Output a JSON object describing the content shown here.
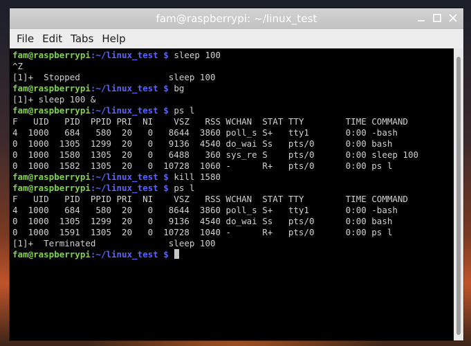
{
  "window": {
    "title": "fam@raspberrypi: ~/linux_test"
  },
  "menu": [
    "File",
    "Edit",
    "Tabs",
    "Help"
  ],
  "prompt": {
    "user": "fam@raspberrypi",
    "path": ":~/linux_test $"
  },
  "lines": [
    {
      "type": "prompt",
      "cmd": "sleep 100"
    },
    {
      "type": "out",
      "text": "^Z"
    },
    {
      "type": "out",
      "text": "[1]+  Stopped                 sleep 100"
    },
    {
      "type": "prompt",
      "cmd": "bg"
    },
    {
      "type": "out",
      "text": "[1]+ sleep 100 &"
    },
    {
      "type": "prompt",
      "cmd": "ps l"
    },
    {
      "type": "out",
      "text": "F   UID   PID  PPID PRI  NI    VSZ   RSS WCHAN  STAT TTY        TIME COMMAND"
    },
    {
      "type": "out",
      "text": "4  1000   684   580  20   0   8644  3860 poll_s S+   tty1       0:00 -bash"
    },
    {
      "type": "out",
      "text": "0  1000  1305  1299  20   0   9136  4540 do_wai Ss   pts/0      0:00 bash"
    },
    {
      "type": "out",
      "text": "0  1000  1580  1305  20   0   6488   360 sys_re S    pts/0      0:00 sleep 100"
    },
    {
      "type": "out",
      "text": "0  1000  1582  1305  20   0  10728  1060 -      R+   pts/0      0:00 ps l"
    },
    {
      "type": "prompt",
      "cmd": "kill 1580"
    },
    {
      "type": "prompt",
      "cmd": "ps l"
    },
    {
      "type": "out",
      "text": "F   UID   PID  PPID PRI  NI    VSZ   RSS WCHAN  STAT TTY        TIME COMMAND"
    },
    {
      "type": "out",
      "text": "4  1000   684   580  20   0   8644  3860 poll_s S+   tty1       0:00 -bash"
    },
    {
      "type": "out",
      "text": "0  1000  1305  1299  20   0   9136  4540 do_wai Ss   pts/0      0:00 bash"
    },
    {
      "type": "out",
      "text": "0  1000  1591  1305  20   0  10728  1040 -      R+   pts/0      0:00 ps l"
    },
    {
      "type": "out",
      "text": "[1]+  Terminated              sleep 100"
    },
    {
      "type": "prompt",
      "cmd": "",
      "cursor": true
    }
  ]
}
